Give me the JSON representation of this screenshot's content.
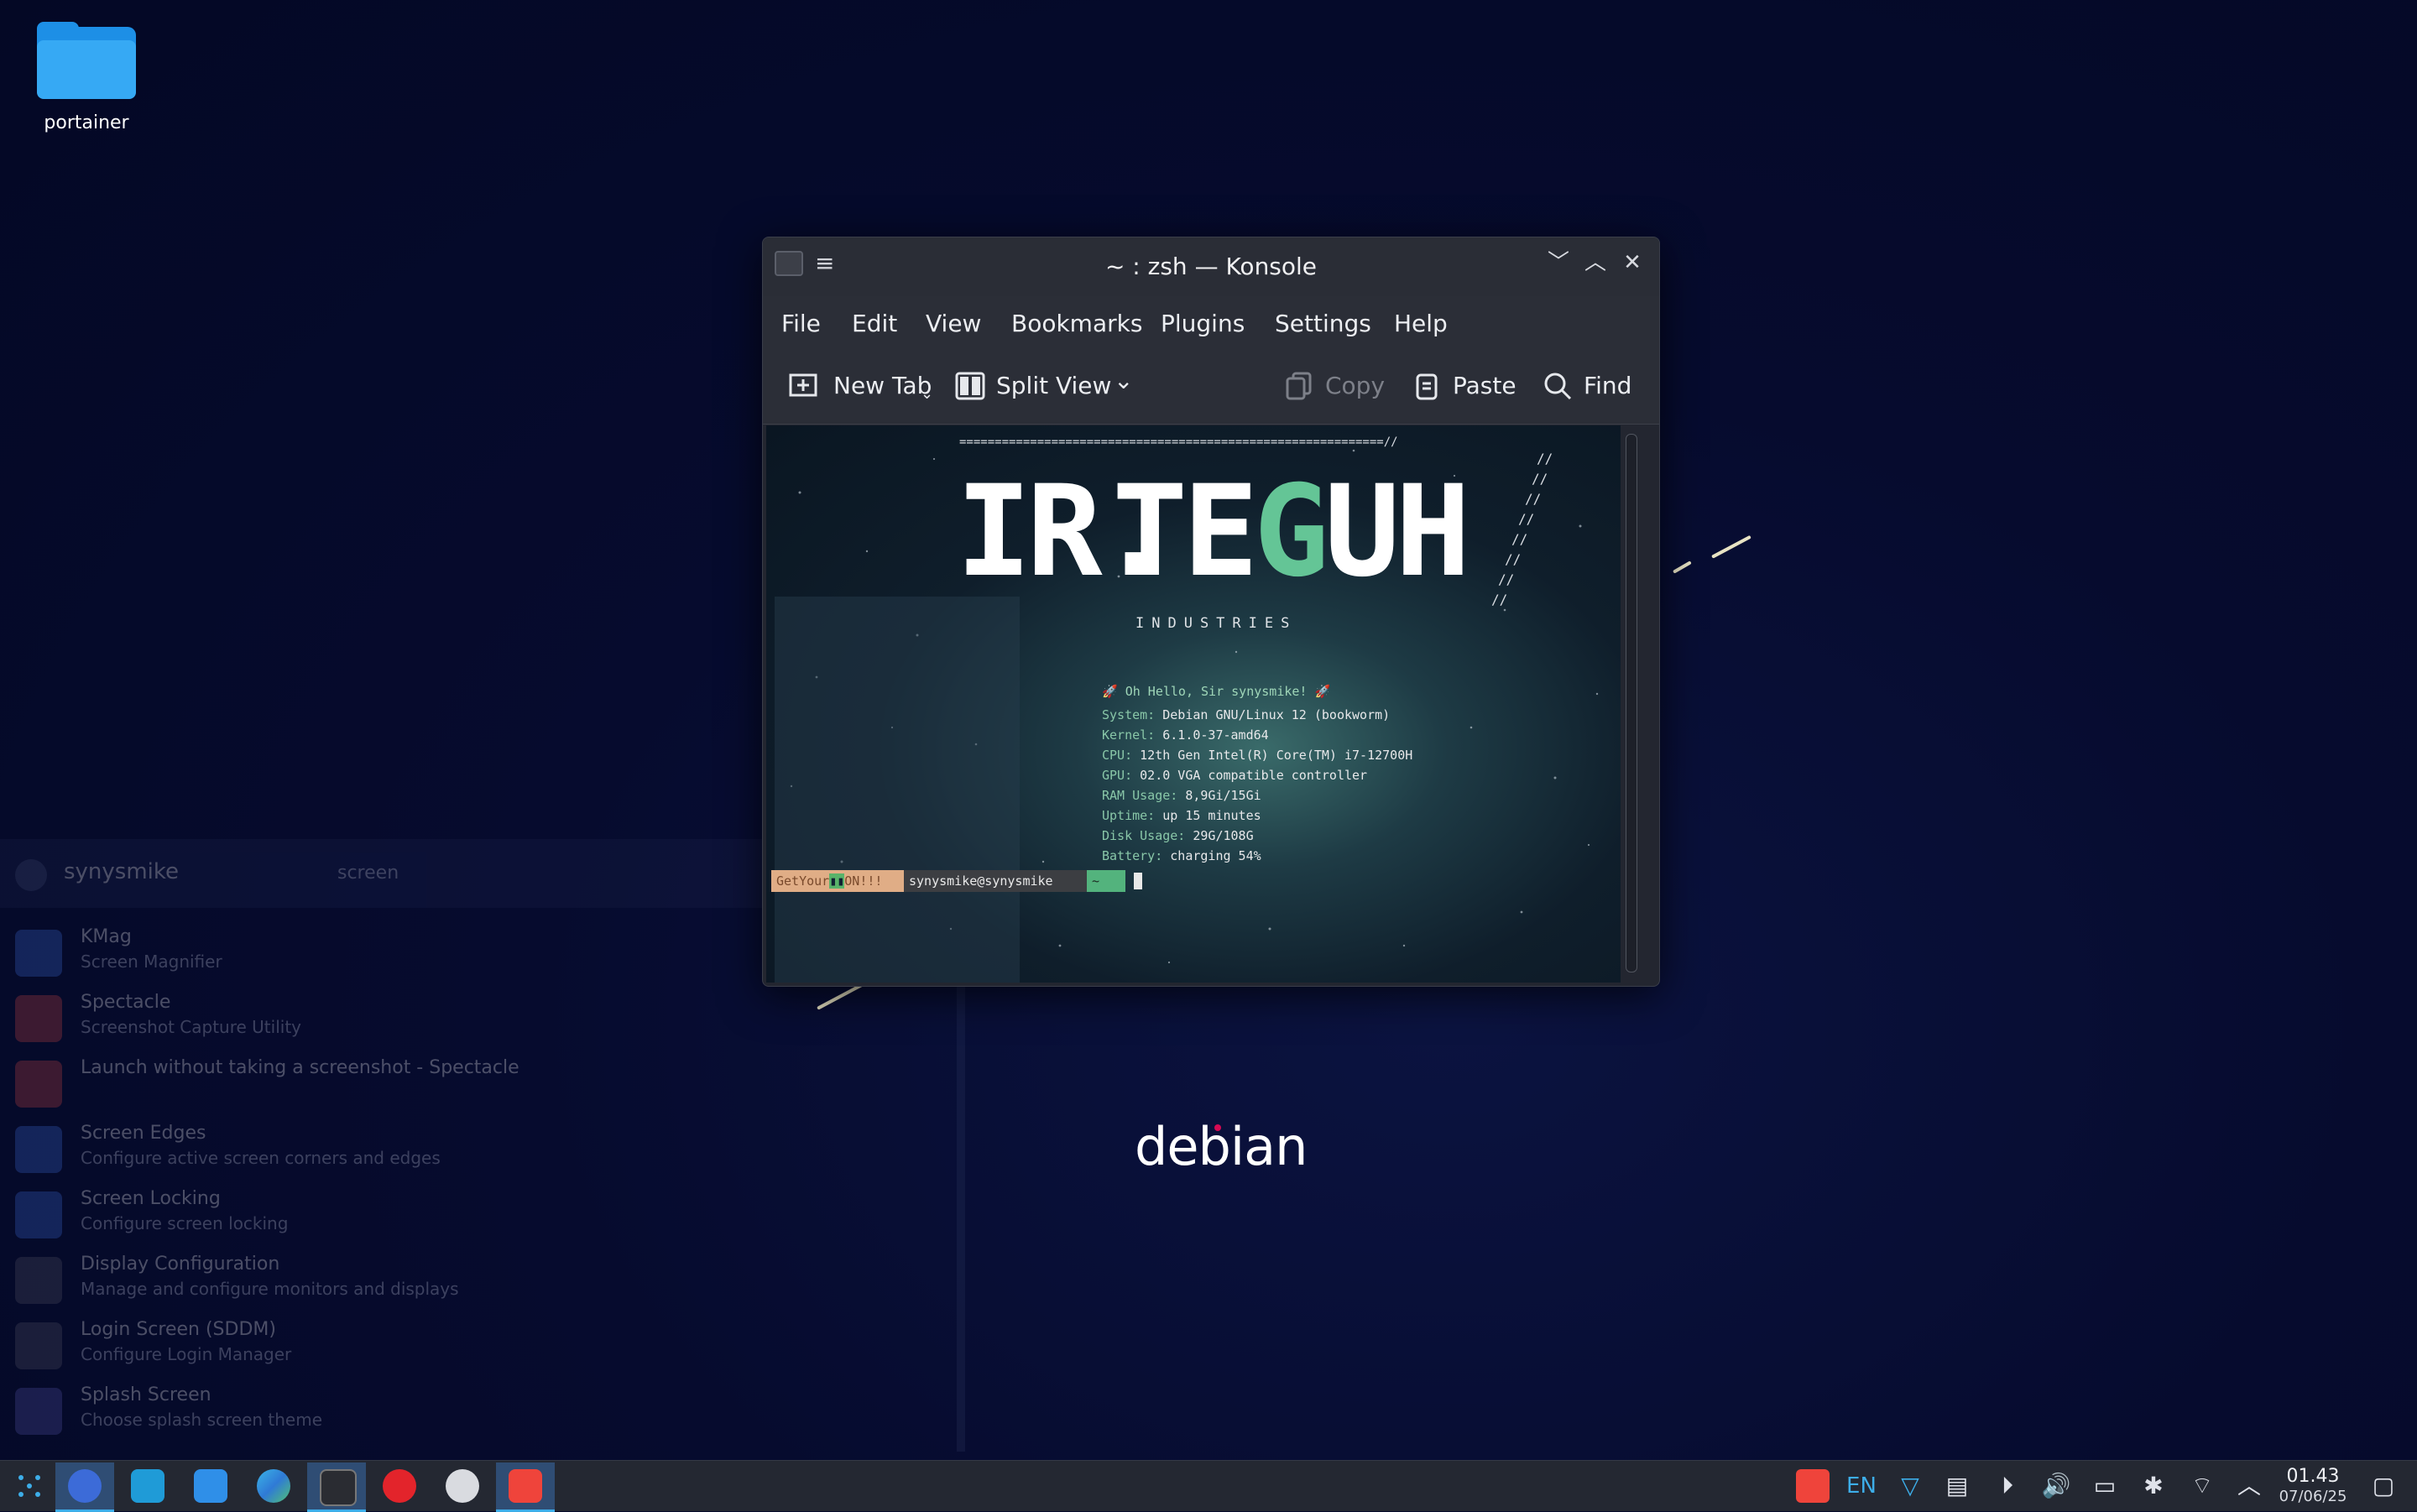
{
  "desktop": {
    "icons": [
      {
        "label": "portainer",
        "icon": "folder-icon"
      }
    ],
    "logo_text": "debian"
  },
  "launcher": {
    "user": "synysmike",
    "query": "screen",
    "results": [
      {
        "title": "KMag",
        "subtitle": "Screen Magnifier"
      },
      {
        "title": "Spectacle",
        "subtitle": "Screenshot Capture Utility"
      },
      {
        "title": "Launch without taking a screenshot - Spectacle",
        "subtitle": ""
      },
      {
        "title": "Screen Edges",
        "subtitle": "Configure active screen corners and edges"
      },
      {
        "title": "Screen Locking",
        "subtitle": "Configure screen locking"
      },
      {
        "title": "Display Configuration",
        "subtitle": "Manage and configure monitors and displays"
      },
      {
        "title": "Login Screen (SDDM)",
        "subtitle": "Configure Login Manager"
      },
      {
        "title": "Splash Screen",
        "subtitle": "Choose splash screen theme"
      }
    ]
  },
  "window": {
    "title": "~ : zsh — Konsole",
    "menu": [
      "File",
      "Edit",
      "View",
      "Bookmarks",
      "Plugins",
      "Settings",
      "Help"
    ],
    "toolbar": {
      "new_tab": "New Tab",
      "split_view": "Split View",
      "copy": "Copy",
      "paste": "Paste",
      "find": "Find"
    }
  },
  "terminal": {
    "banner_title_1": "IR.",
    "banner_title_2": "TE",
    "banner_title_g": "G",
    "banner_title_3": "UH",
    "banner_sub": "INDUSTRIES",
    "greeting": "Oh Hello, Sir synysmike!",
    "info": [
      {
        "key": "System:",
        "value": "Debian GNU/Linux 12 (bookworm)"
      },
      {
        "key": "Kernel:",
        "value": "6.1.0-37-amd64"
      },
      {
        "key": "CPU:",
        "value": "12th Gen Intel(R) Core(TM) i7-12700H"
      },
      {
        "key": "GPU:",
        "value": "02.0 VGA compatible controller"
      },
      {
        "key": "RAM Usage:",
        "value": "8,9Gi/15Gi"
      },
      {
        "key": "Uptime:",
        "value": "up 15 minutes"
      },
      {
        "key": "Disk Usage:",
        "value": "29G/108G"
      },
      {
        "key": "Battery:",
        "value": "charging 54%"
      }
    ],
    "prompt_seg1": "GetYour",
    "prompt_seg1b": "ON!!!",
    "prompt_user": "synysmike@synysmike",
    "prompt_dir": "~"
  },
  "taskbar": {
    "tray_lang": "EN",
    "time": "01.43",
    "date": "07/06/25"
  }
}
